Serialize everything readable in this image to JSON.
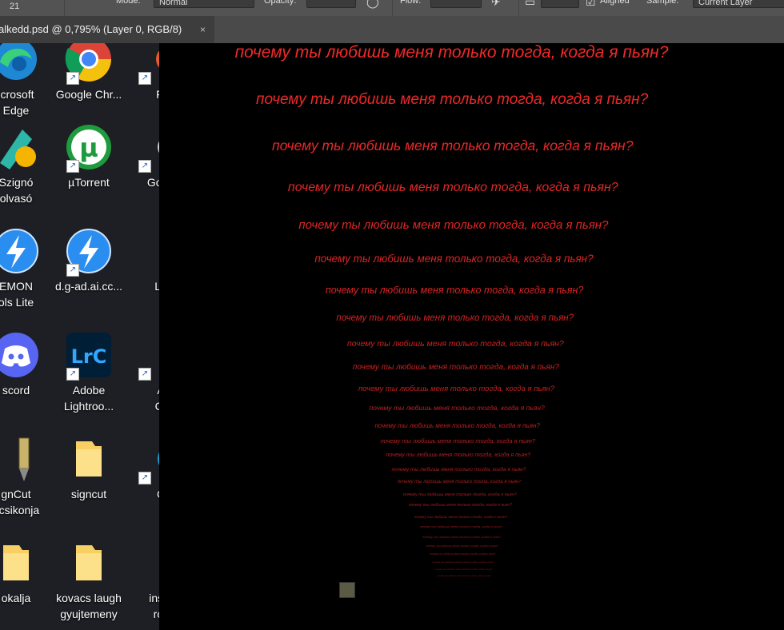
{
  "options_bar": {
    "brush_size": "21",
    "mode_label": "Mode:",
    "mode_value": "Normal",
    "opacity_label": "Opacity:",
    "flow_label": "Flow:",
    "aligned_label": "Aligned",
    "sample_label": "Sample:",
    "sample_value": "Current Layer"
  },
  "document_tab": {
    "title": "alkedd.psd @ 0,795% (Layer 0, RGB/8)",
    "close_glyph": "×"
  },
  "desktop": {
    "icons": [
      {
        "name": "microsoft-edge",
        "label": "icrosoft\nEdge"
      },
      {
        "name": "google-chrome",
        "label": "Google Chr..."
      },
      {
        "name": "firefox",
        "label": "Fi"
      },
      {
        "name": "szigno",
        "label": "Szignó\nolvasó"
      },
      {
        "name": "utorrent",
        "label": "µTorrent"
      },
      {
        "name": "google",
        "label": "Goog"
      },
      {
        "name": "daemon-tools",
        "label": "EMON\nols Lite"
      },
      {
        "name": "dg-ad",
        "label": "d.g-ad.ai.cc..."
      },
      {
        "name": "lo",
        "label": "Lo"
      },
      {
        "name": "discord",
        "label": "scord"
      },
      {
        "name": "lightroom",
        "label": "Adobe\nLightroo..."
      },
      {
        "name": "adobe-cr",
        "label": "A\nCr"
      },
      {
        "name": "signcut",
        "label": "gnCut\nncsikonja"
      },
      {
        "name": "signcut-folder",
        "label": "signcut"
      },
      {
        "name": "c-app",
        "label": "C"
      },
      {
        "name": "bokalja",
        "label": "okalja"
      },
      {
        "name": "kovacs-folder",
        "label": "kovacs laugh\ngyujtemeny"
      },
      {
        "name": "install",
        "label": "insta\nroll"
      }
    ],
    "lightroom_text": "LrC",
    "utorrent_glyph": "µ"
  },
  "canvas": {
    "phrase": "почему ты любишь меня только тогда, когда я пьян?",
    "text_color": "#ff2c2c"
  }
}
